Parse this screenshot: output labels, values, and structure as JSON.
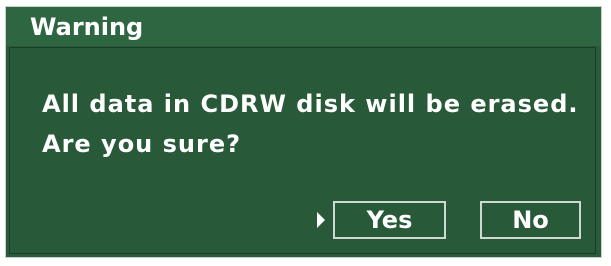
{
  "dialog": {
    "title": "Warning",
    "message_lines": [
      "All data in CDRW disk will be erased.",
      "Are you sure?"
    ],
    "buttons": {
      "yes_label": "Yes",
      "no_label": "No"
    },
    "focused_button": "Yes"
  },
  "colors": {
    "background": "#295b3a",
    "title_bar": "#2f6642",
    "text": "#ffffff",
    "border": "#d0d8d2"
  }
}
